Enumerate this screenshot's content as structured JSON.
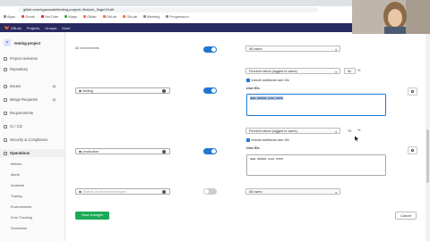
{
  "browser": {
    "url": "gitlab.com/sgarowski/testing-project/-/feature_flags/1/edit",
    "bookmarks": [
      "Apps",
      "Gmail",
      "YouTube",
      "Maps",
      "Gitlab",
      "GitLab",
      "GitLab",
      "Meeting",
      "Progression",
      "Schedule",
      "Progression"
    ]
  },
  "topnav": {
    "items": [
      "GitLab",
      "Projects",
      "Groups",
      "More"
    ]
  },
  "sidebar": {
    "project_initial": "T",
    "project_name": "testing-project",
    "items": [
      {
        "label": "Project overview"
      },
      {
        "label": "Repository"
      },
      {
        "label": "Issues",
        "badge": "0"
      },
      {
        "label": "Merge Requests",
        "badge": "0"
      },
      {
        "label": "Requirements"
      },
      {
        "label": "CI / CD"
      },
      {
        "label": "Security & Compliance"
      },
      {
        "label": "Operations"
      }
    ],
    "subitems": [
      "Metrics",
      "Alerts",
      "Incidents",
      "Tracing",
      "Environments",
      "Error Tracking",
      "Serverless"
    ]
  },
  "main": {
    "row_all": {
      "title": "All environments",
      "strategy": "All users"
    },
    "row_testing": {
      "environment": "testing",
      "strategy": "Percent rollout (logged in users)",
      "percent": "50",
      "unit": "%",
      "include_label": "Include additional user IDs",
      "userids_label": "User IDs",
      "userids_value": "aaa, ddddd, cccc, eeee"
    },
    "row_production": {
      "environment": "production",
      "strategy": "Percent rollout (logged in users)",
      "percent": "75",
      "unit": "%",
      "include_label": "Include additional user IDs",
      "userids_label": "User IDs",
      "userids_value": "aaa, ddddd, cccc, eeee"
    },
    "row_new": {
      "placeholder": "Search an environment spec",
      "strategy": "All users"
    },
    "save_label": "Save changes",
    "cancel_label": "Cancel"
  },
  "colors": {
    "nav": "#292961",
    "accent": "#1f78d1",
    "save": "#1aaa55"
  }
}
